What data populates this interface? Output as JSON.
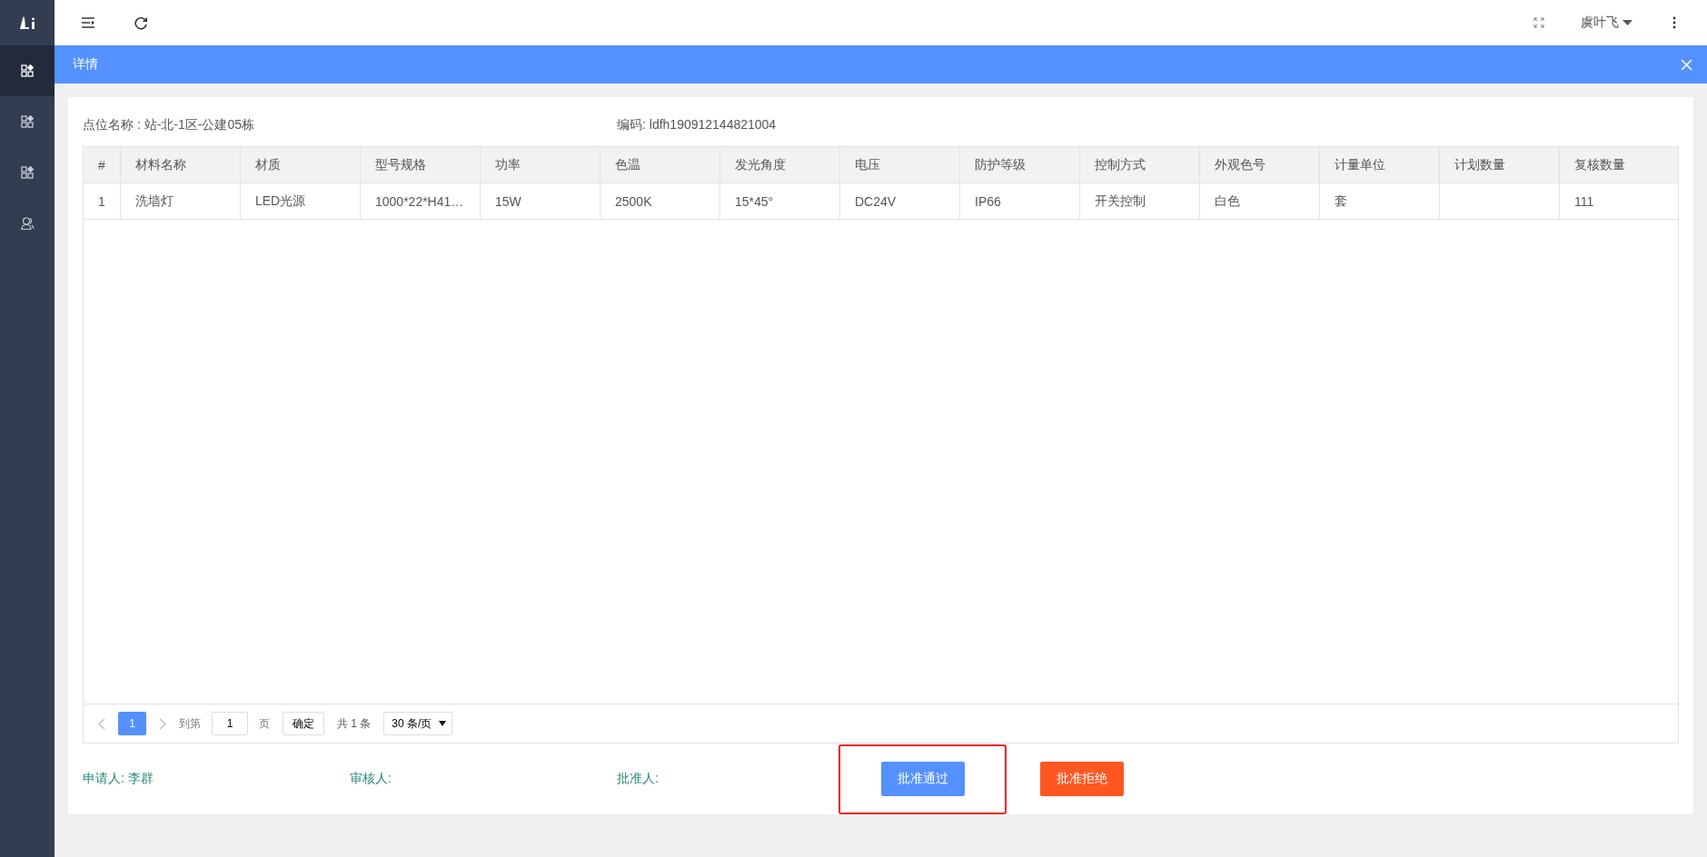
{
  "sidebar": {
    "items": [
      {
        "kind": "apps",
        "selected": true
      },
      {
        "kind": "apps",
        "selected": false
      },
      {
        "kind": "apps",
        "selected": false
      },
      {
        "kind": "user",
        "selected": false
      }
    ]
  },
  "topbar": {
    "user": "虞叶飞"
  },
  "panel": {
    "title": "详情"
  },
  "info": {
    "location": "点位名称 : 站-北-1区-公建05栋",
    "code": "编码: ldfh190912144821004"
  },
  "table": {
    "columns": [
      "#",
      "材料名称",
      "材质",
      "型号规格",
      "功率",
      "色温",
      "发光角度",
      "电压",
      "防护等级",
      "控制方式",
      "外观色号",
      "计量单位",
      "计划数量",
      "复核数量"
    ],
    "rows": [
      [
        "1",
        "洗墙灯",
        "LED光源",
        "1000*22*H41…",
        "15W",
        "2500K",
        "15*45°",
        "DC24V",
        "IP66",
        "开关控制",
        "白色",
        "套",
        "",
        "111"
      ]
    ]
  },
  "pagination": {
    "pages": [
      {
        "label": "1",
        "selected": true
      }
    ],
    "goto_label": "到第",
    "goto_value": "1",
    "page_unit": "页",
    "confirm": "确定",
    "total": "共 1 条",
    "page_size": "30 条/页"
  },
  "footer": {
    "applicant": "申请人: 李群",
    "reviewer": "审核人:",
    "approver": "批准人:"
  },
  "actions": [
    {
      "label": "批准通过",
      "kind": "approve",
      "highlighted": true
    },
    {
      "label": "批准拒绝",
      "kind": "reject",
      "highlighted": false
    }
  ]
}
